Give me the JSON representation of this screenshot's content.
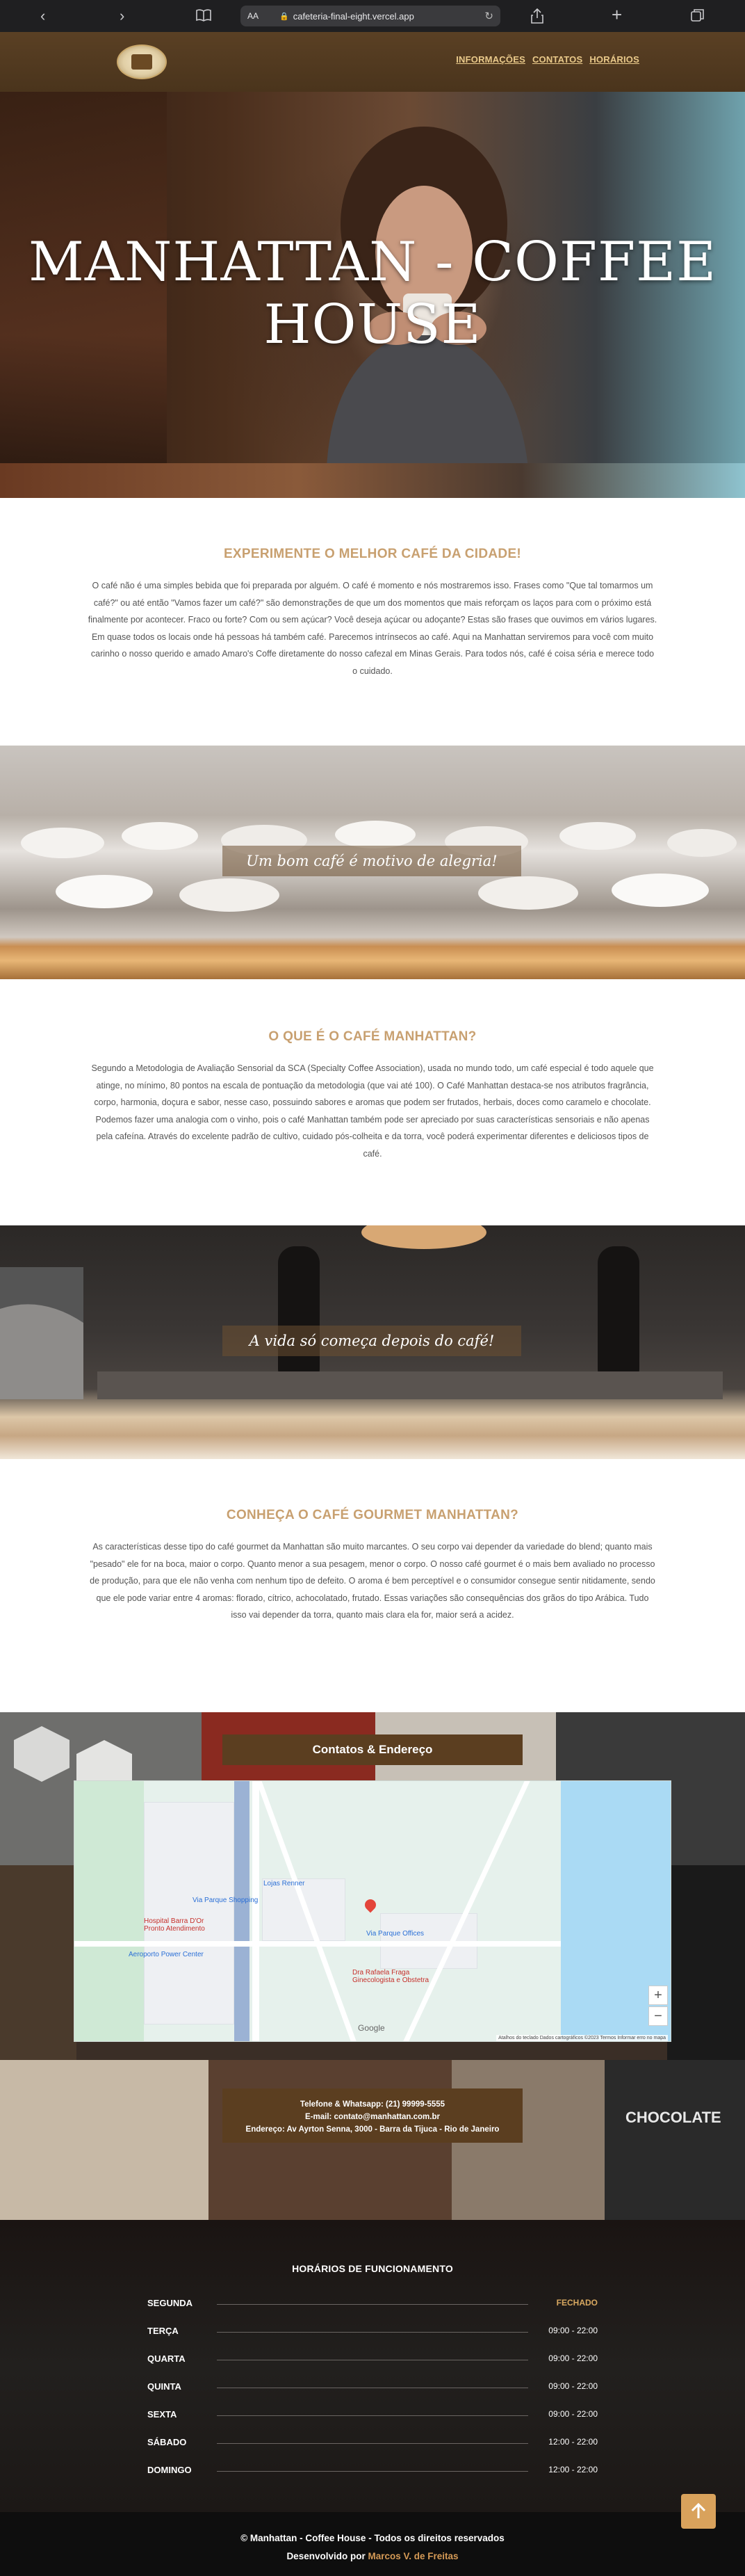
{
  "browser": {
    "url": "cafeteria-final-eight.vercel.app",
    "aa": "AA",
    "back_icon": "chevron-left-icon",
    "forward_icon": "chevron-right-icon",
    "bookmarks_icon": "book-icon",
    "share_icon": "share-icon",
    "new_tab_icon": "plus-icon",
    "tabs_icon": "tabs-icon"
  },
  "header": {
    "nav": [
      "INFORMAÇÕES",
      "CONTATOS",
      "HORÁRIOS"
    ]
  },
  "hero": {
    "title_line1": "MANHATTAN - COFFEE",
    "title_line2": "HOUSE"
  },
  "section1": {
    "title": "EXPERIMENTE O MELHOR CAFÉ DA CIDADE!",
    "body": "O café não é uma simples bebida que foi preparada por alguém. O café é momento e nós mostraremos isso. Frases como \"Que tal tomarmos um café?\" ou até então \"Vamos fazer um café?\" são demonstrações de que um dos momentos que mais reforçam os laços para com o próximo está finalmente por acontecer. Fraco ou forte? Com ou sem açúcar? Você deseja açúcar ou adoçante? Estas são frases que ouvimos em vários lugares. Em quase todos os locais onde há pessoas há também café. Parecemos intrínsecos ao café. Aqui na Manhattan serviremos para você com muito carinho o nosso querido e amado Amaro's Coffe diretamente do nosso cafezal em Minas Gerais. Para todos nós, café é coisa séria e merece todo o cuidado."
  },
  "band1": {
    "caption": "Um bom café é motivo de alegria!"
  },
  "section2": {
    "title": "O QUE É O CAFÉ MANHATTAN?",
    "body": "Segundo a Metodologia de Avaliação Sensorial da SCA (Specialty Coffee Association), usada no mundo todo, um café especial é todo aquele que atinge, no mínimo, 80 pontos na escala de pontuação da metodologia (que vai até 100). O Café Manhattan destaca-se nos atributos fragrância, corpo, harmonia, doçura e sabor, nesse caso, possuindo sabores e aromas que podem ser frutados, herbais, doces como caramelo e chocolate. Podemos fazer uma analogia com o vinho, pois o café Manhattan também pode ser apreciado por suas características sensoriais e não apenas pela cafeína. Através do excelente padrão de cultivo, cuidado pós-colheita e da torra, você poderá experimentar diferentes e deliciosos tipos de café."
  },
  "band2": {
    "caption": "A vida só começa depois do café!"
  },
  "section3": {
    "title": "CONHEÇA O CAFÉ GOURMET MANHATTAN?",
    "body": "As características desse tipo do café gourmet da Manhattan são muito marcantes. O seu corpo vai depender da variedade do blend; quanto mais \"pesado\" ele for na boca, maior o corpo. Quanto menor a sua pesagem, menor o corpo. O nosso café gourmet é o mais bem avaliado no processo de produção, para que ele não venha com nenhum tipo de defeito. O aroma é bem perceptível e o consumidor consegue sentir nitidamente, sendo que ele pode variar entre 4 aromas: florado, cítrico, achocolatado, frutado. Essas variações são consequências dos grãos do tipo Arábica. Tudo isso vai depender da torra, quanto mais clara ela for, maior será a acidez."
  },
  "contact": {
    "title": "Contatos & Endereço",
    "phone": "Telefone & Whatsapp: (21) 99999-5555",
    "email": "E-mail: contato@manhattan.com.br",
    "address": "Endereço: Av Ayrton Senna, 3000 - Barra da Tijuca - Rio de Janeiro"
  },
  "map": {
    "labels": {
      "lojas": "Lojas Renner",
      "shopping": "Via Parque Shopping",
      "hospital": "Hospital Barra D'Or\nPronto Atendimento",
      "aeroporto": "Aeroporto Power Center",
      "offices": "Via Parque Offices",
      "dra": "Dra Rafaela Fraga\nGinecologista e Obstetra",
      "google": "Google",
      "attribution": "Atalhos do teclado  Dados cartográficos ©2023  Termos  Informar erro no mapa",
      "zoom_in": "+",
      "zoom_out": "−"
    }
  },
  "hours": {
    "title": "HORÁRIOS DE FUNCIONAMENTO",
    "rows": [
      {
        "day": "SEGUNDA",
        "time": "FECHADO"
      },
      {
        "day": "TERÇA",
        "time": "09:00 - 22:00"
      },
      {
        "day": "QUARTA",
        "time": "09:00 - 22:00"
      },
      {
        "day": "QUINTA",
        "time": "09:00 - 22:00"
      },
      {
        "day": "SEXTA",
        "time": "09:00 - 22:00"
      },
      {
        "day": "SÁBADO",
        "time": "12:00 - 22:00"
      },
      {
        "day": "DOMINGO",
        "time": "12:00 - 22:00"
      }
    ]
  },
  "footer": {
    "line1": "© Manhattan - Coffee House - Todos os direitos reservados",
    "line2_prefix": "Desenvolvido por ",
    "author": "Marcos V. de Freitas"
  },
  "colors": {
    "brand_brown": "#5b3e20",
    "title_gold": "#c8a070",
    "closed": "#d8a860",
    "to_top": "#d9a25c"
  },
  "back_to_top_icon": "arrow-up-icon"
}
